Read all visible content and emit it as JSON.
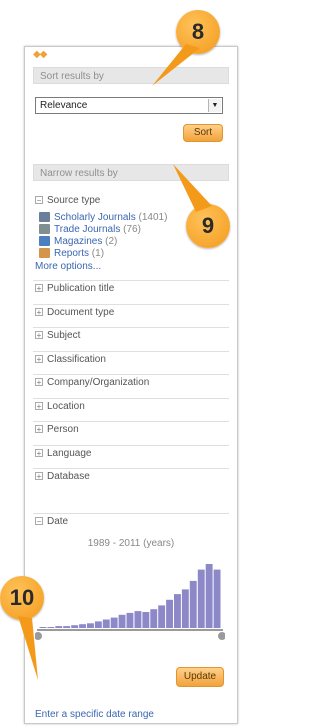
{
  "sort": {
    "header": "Sort results by",
    "selected": "Relevance",
    "button": "Sort"
  },
  "narrow": {
    "header": "Narrow results by",
    "source_type": {
      "label": "Source type",
      "items": [
        {
          "label": "Scholarly Journals",
          "count": "(1401)",
          "icon": "journal-icon",
          "color": "#6a7f9a"
        },
        {
          "label": "Trade Journals",
          "count": "(76)",
          "icon": "trade-journal-icon",
          "color": "#7f8f8f"
        },
        {
          "label": "Magazines",
          "count": "(2)",
          "icon": "magazine-icon",
          "color": "#4b7fbf"
        },
        {
          "label": "Reports",
          "count": "(1)",
          "icon": "report-icon",
          "color": "#d4954a"
        }
      ],
      "more": "More options..."
    },
    "facets": [
      "Publication title",
      "Document type",
      "Subject",
      "Classification",
      "Company/Organization",
      "Location",
      "Person",
      "Language",
      "Database"
    ],
    "date": {
      "label": "Date",
      "range": "1989 - 2011 (years)",
      "update": "Update",
      "specific_link": "Enter a specific date range"
    }
  },
  "histogram": {
    "start_year": 1989,
    "end_year": 2011,
    "values": [
      1,
      1,
      2,
      2,
      3,
      4,
      5,
      7,
      9,
      11,
      14,
      16,
      18,
      17,
      20,
      24,
      30,
      36,
      41,
      50,
      62,
      68,
      62
    ],
    "bar_color": "#8d89c9"
  },
  "callouts": [
    "8",
    "9",
    "10"
  ],
  "colors": {
    "accent": "#f0a23a",
    "link": "#3a67b0"
  }
}
